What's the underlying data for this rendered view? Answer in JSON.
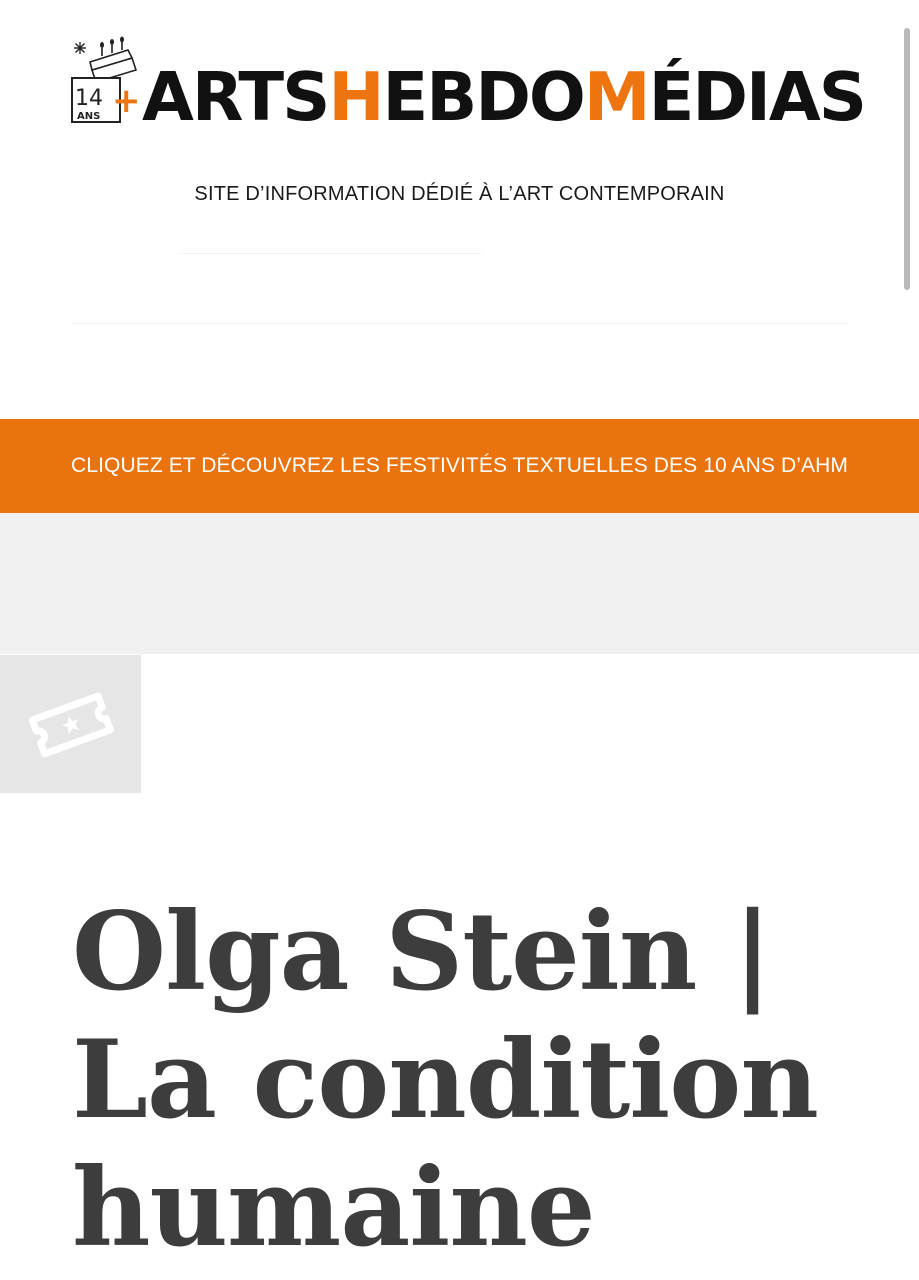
{
  "header": {
    "logo": {
      "badge_years": "14",
      "badge_unit": "ANS",
      "badge_plus": "+",
      "text_parts": [
        "ARTS",
        "H",
        "EBDO",
        "M",
        "ÉDIAS"
      ]
    },
    "tagline": "SITE D’INFORMATION DÉDIÉ À L’ART CONTEMPORAIN"
  },
  "banner": {
    "text": "CLIQUEZ ET DÉCOUVREZ LES FESTIVITÉS TEXTUELLES DES 10 ANS D’AHM"
  },
  "category": {
    "icon": "ticket-icon"
  },
  "article": {
    "title": "Olga Stein | La condition humaine"
  },
  "colors": {
    "brand_orange": "#eb730d",
    "title_gray": "#3d3d3d",
    "band_gray": "#f0f0f1"
  }
}
